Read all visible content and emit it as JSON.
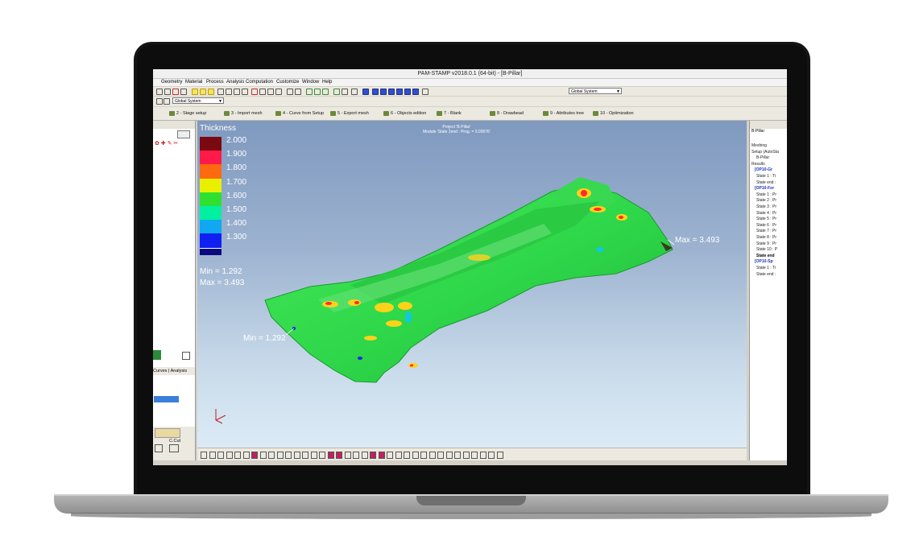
{
  "window": {
    "title": "PAM-STAMP v2018.0.1 (64-bit) - [B-Pillar]"
  },
  "menu": [
    "Geometry",
    "Material",
    "Process",
    "Analysis",
    "Computation",
    "Customize",
    "Window",
    "Help"
  ],
  "toolbar": {
    "coord_system": "Global System",
    "coord_system_small": "Global System"
  },
  "stages": [
    {
      "label": "2 - Stage setup"
    },
    {
      "label": "3 - Import mesh"
    },
    {
      "label": "4 - Curve from Setup"
    },
    {
      "label": "5 - Export mesh"
    },
    {
      "label": "6 - Objects edition"
    },
    {
      "label": "7 - Blank"
    },
    {
      "label": "8 - Drawbead"
    },
    {
      "label": "9 - Attributes tree"
    },
    {
      "label": "10 - Optimization"
    }
  ],
  "left_panel": {
    "tabs_label": "Curves | Analysis",
    "ccut_label": "C.Cut"
  },
  "viewport": {
    "project_line1": "Project 'B-Pillar'",
    "project_line2": "Module 'State 2end : Prog. = 0.00076'",
    "legend": {
      "title": "Thickness",
      "levels": [
        {
          "value": "2.000",
          "color": "#7a0a10"
        },
        {
          "value": "1.900",
          "color": "#ff1a4a"
        },
        {
          "value": "1.800",
          "color": "#ff6a10"
        },
        {
          "value": "1.700",
          "color": "#e8f000"
        },
        {
          "value": "1.600",
          "color": "#30e030"
        },
        {
          "value": "1.500",
          "color": "#00f0a0"
        },
        {
          "value": "1.400",
          "color": "#10a8f0"
        },
        {
          "value": "1.300",
          "color": "#1020f0"
        },
        {
          "value": "",
          "color": "#0a0a80"
        }
      ],
      "min_label": "Min =  1.292",
      "max_label": "Max =  3.493"
    },
    "min_annotation": "Min = 1.292",
    "max_annotation": "Max = 3.493"
  },
  "tree": {
    "header": "B-Pillar",
    "items": [
      {
        "label": "Meshing",
        "style": "normal"
      },
      {
        "label": "Setup (AutoSta",
        "style": "normal"
      },
      {
        "label": "B-Pillar",
        "style": "normal"
      },
      {
        "label": "Results",
        "style": "normal"
      },
      {
        "label": "[OP10-Gr",
        "style": "blue"
      },
      {
        "label": "State 1 : Ti",
        "style": "normal"
      },
      {
        "label": "State end :",
        "style": "normal"
      },
      {
        "label": "[OP10-For",
        "style": "blue"
      },
      {
        "label": "State 1 : Pr",
        "style": "normal"
      },
      {
        "label": "State 2 : Pr",
        "style": "normal"
      },
      {
        "label": "State 3 : Pr",
        "style": "normal"
      },
      {
        "label": "State 4 : Pr",
        "style": "normal"
      },
      {
        "label": "State 5 : Pr",
        "style": "normal"
      },
      {
        "label": "State 6 : Pr",
        "style": "normal"
      },
      {
        "label": "State 7 : Pr",
        "style": "normal"
      },
      {
        "label": "State 8 : Pr",
        "style": "normal"
      },
      {
        "label": "State 9 : Pr",
        "style": "normal"
      },
      {
        "label": "State 10 : P",
        "style": "normal"
      },
      {
        "label": "State end",
        "style": "bold"
      },
      {
        "label": "[OP10-Sp",
        "style": "blue"
      },
      {
        "label": "State 1 : Ti",
        "style": "normal"
      },
      {
        "label": "State end :",
        "style": "normal"
      }
    ]
  },
  "colors": {
    "part_base": "#2fd84a",
    "hot": "#ff2a2a",
    "warm": "#ffd21a",
    "cool": "#10c8e0"
  }
}
